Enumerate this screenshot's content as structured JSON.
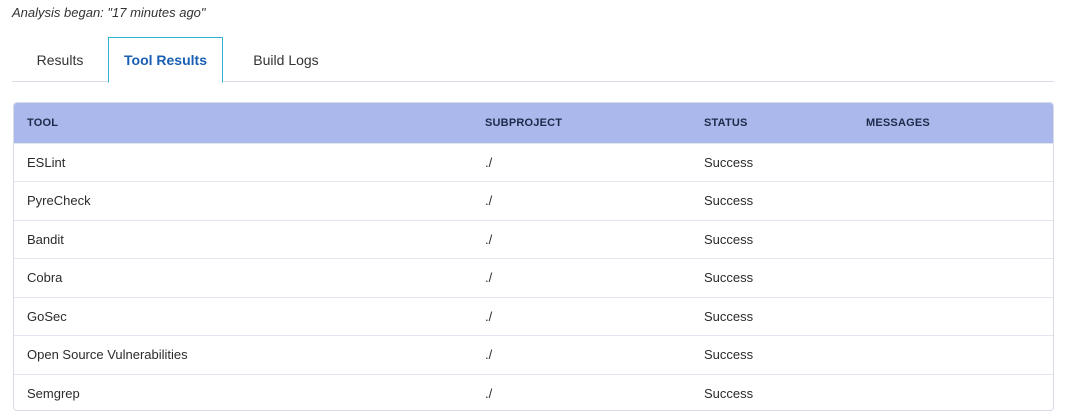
{
  "analysis_note": "Analysis began: \"17 minutes ago\"",
  "tabs": [
    {
      "label": "Results",
      "active": false
    },
    {
      "label": "Tool Results",
      "active": true
    },
    {
      "label": "Build Logs",
      "active": false
    }
  ],
  "table": {
    "headers": {
      "tool": "TOOL",
      "subproject": "SUBPROJECT",
      "status": "STATUS",
      "messages": "MESSAGES"
    },
    "rows": [
      {
        "tool": "ESLint",
        "subproject": "./",
        "status": "Success",
        "messages": ""
      },
      {
        "tool": "PyreCheck",
        "subproject": "./",
        "status": "Success",
        "messages": ""
      },
      {
        "tool": "Bandit",
        "subproject": "./",
        "status": "Success",
        "messages": ""
      },
      {
        "tool": "Cobra",
        "subproject": "./",
        "status": "Success",
        "messages": ""
      },
      {
        "tool": "GoSec",
        "subproject": "./",
        "status": "Success",
        "messages": ""
      },
      {
        "tool": "Open Source Vulnerabilities",
        "subproject": "./",
        "status": "Success",
        "messages": ""
      },
      {
        "tool": "Semgrep",
        "subproject": "./",
        "status": "Success",
        "messages": ""
      }
    ]
  },
  "colors": {
    "header_bg": "#abb8eb",
    "active_tab_border": "#36b1d3",
    "active_tab_text": "#1a5fb4"
  }
}
